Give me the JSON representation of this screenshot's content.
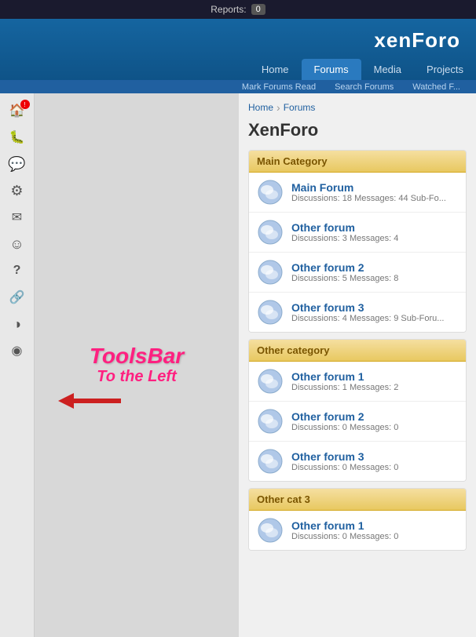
{
  "topBar": {
    "reportsLabel": "Reports:",
    "reportsCount": "0"
  },
  "header": {
    "logo": {
      "prefix": "xen",
      "suffix": "Foro"
    },
    "navTabs": [
      {
        "label": "Home",
        "active": false
      },
      {
        "label": "Forums",
        "active": true
      },
      {
        "label": "Media",
        "active": false
      },
      {
        "label": "Projects",
        "active": false
      }
    ],
    "subNavItems": [
      {
        "label": "Mark Forums Read"
      },
      {
        "label": "Search Forums"
      },
      {
        "label": "Watched F..."
      }
    ]
  },
  "toolbar": {
    "label": "ToolsBar",
    "sublabel": "To the Left",
    "items": [
      {
        "icon": "🏠",
        "name": "home-icon",
        "hasBadge": true
      },
      {
        "icon": "🐛",
        "name": "bug-icon",
        "hasBadge": false
      },
      {
        "icon": "💬",
        "name": "chat-icon",
        "hasBadge": false
      },
      {
        "icon": "⚙",
        "name": "settings-icon",
        "hasBadge": false
      },
      {
        "icon": "✉",
        "name": "mail-icon",
        "hasBadge": false
      },
      {
        "icon": "☺",
        "name": "smile-icon",
        "hasBadge": false
      },
      {
        "icon": "?",
        "name": "help-icon",
        "hasBadge": false
      },
      {
        "icon": "🔗",
        "name": "link-icon",
        "hasBadge": false
      },
      {
        "icon": "◑",
        "name": "chart-icon",
        "hasBadge": false
      },
      {
        "icon": "◉",
        "name": "feed-icon",
        "hasBadge": false
      }
    ]
  },
  "breadcrumb": {
    "home": "Home",
    "forums": "Forums"
  },
  "pageTitle": "XenForo",
  "categories": [
    {
      "name": "Main Category",
      "forums": [
        {
          "name": "Main Forum",
          "discussions": 18,
          "messages": 44,
          "extra": "Sub-Fo..."
        },
        {
          "name": "Other forum",
          "discussions": 3,
          "messages": 4,
          "extra": ""
        },
        {
          "name": "Other forum 2",
          "discussions": 5,
          "messages": 8,
          "extra": ""
        },
        {
          "name": "Other forum 3",
          "discussions": 4,
          "messages": 9,
          "extra": "Sub-Foru..."
        }
      ]
    },
    {
      "name": "Other category",
      "forums": [
        {
          "name": "Other forum 1",
          "discussions": 1,
          "messages": 2,
          "extra": ""
        },
        {
          "name": "Other forum 2",
          "discussions": 0,
          "messages": 0,
          "extra": ""
        },
        {
          "name": "Other forum 3",
          "discussions": 0,
          "messages": 0,
          "extra": ""
        }
      ]
    },
    {
      "name": "Other cat 3",
      "forums": [
        {
          "name": "Other forum 1",
          "discussions": 0,
          "messages": 0,
          "extra": ""
        }
      ]
    }
  ]
}
